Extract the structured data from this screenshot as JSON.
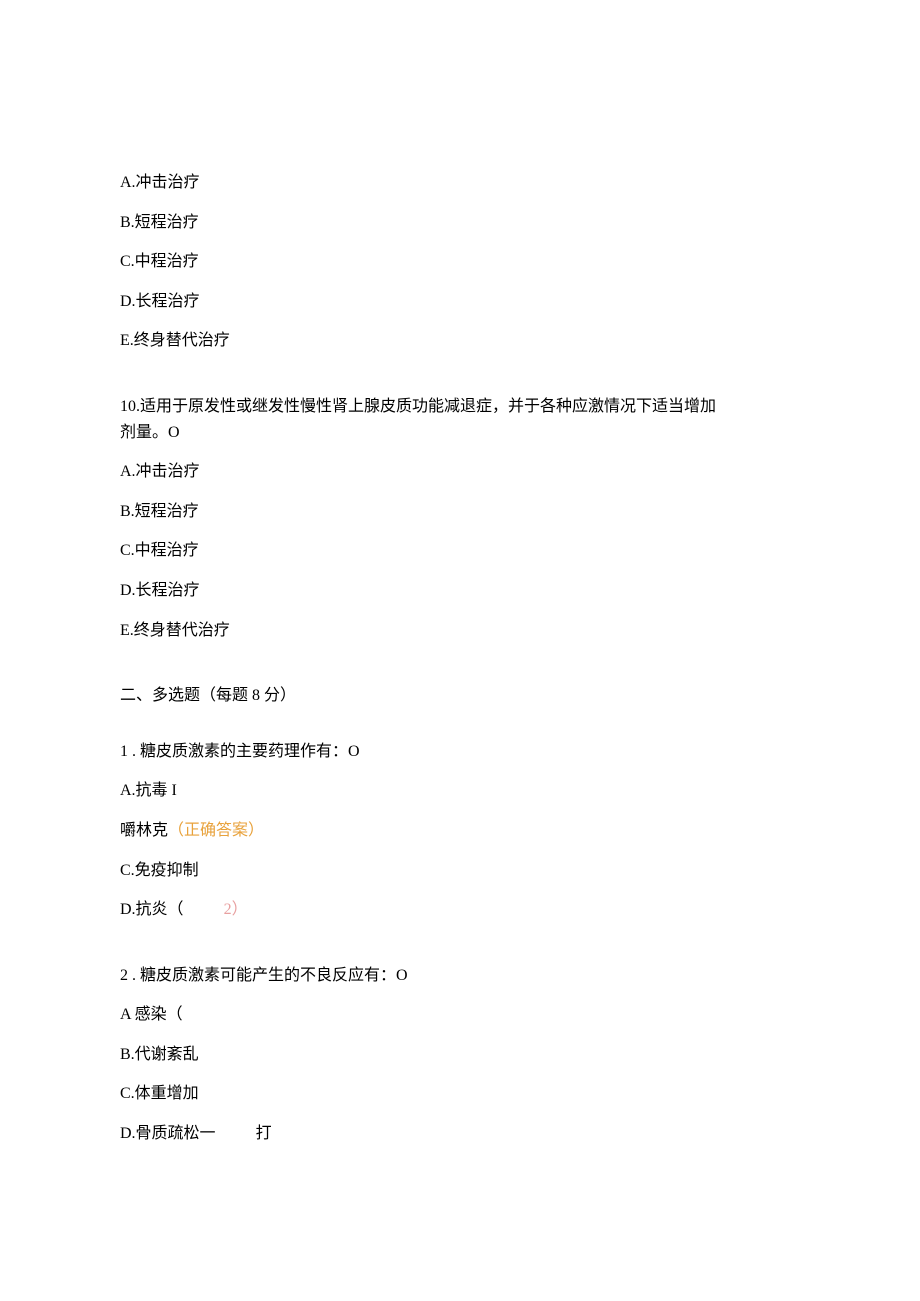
{
  "q9": {
    "options": {
      "a": "A.冲击治疗",
      "b": "B.短程治疗",
      "c": "C.中程治疗",
      "d": "D.长程治疗",
      "e": "E.终身替代治疗"
    }
  },
  "q10": {
    "text_line1": "10.适用于原发性或继发性慢性肾上腺皮质功能减退症，并于各种应激情况下适当增加",
    "text_line2": "剂量。O",
    "options": {
      "a": "A.冲击治疗",
      "b": "B.短程治疗",
      "c": "C.中程治疗",
      "d": "D.长程治疗",
      "e": "E.终身替代治疗"
    }
  },
  "section2": {
    "heading": "二、多选题（每题 8 分）"
  },
  "mq1": {
    "text": "1 . 糖皮质激素的主要药理作有：O",
    "options": {
      "a": "A.抗毒 I",
      "b_text": "嚼林克",
      "b_note": "（正确答案）",
      "c": "C.免疫抑制",
      "d_prefix": "D.抗炎（",
      "d_suffix": "2）"
    }
  },
  "mq2": {
    "text": "2 . 糖皮质激素可能产生的不良反应有：O",
    "options": {
      "a": "A 感染（",
      "b": "B.代谢紊乱",
      "c": "C.体重增加",
      "d_prefix": "D.骨质疏松一",
      "d_suffix": "打"
    }
  }
}
